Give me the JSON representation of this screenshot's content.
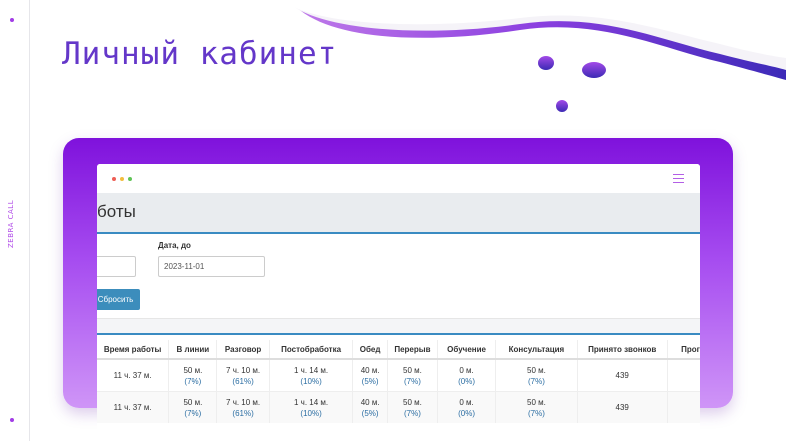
{
  "brand": {
    "side_text": "ZEBRA CALL",
    "accent": "#a23de6"
  },
  "header": {
    "title": "Личный кабинет"
  },
  "window": {
    "page_title": "боты",
    "filters": {
      "date_to_label": "Дата, до",
      "date_to_value": "2023-11-01",
      "reset_label": "Сбросить"
    },
    "table": {
      "columns": [
        "Время работы",
        "В линии",
        "Разговор",
        "Постобработка",
        "Обед",
        "Перерыв",
        "Обучение",
        "Консультация",
        "Принято звонков",
        "Прог"
      ],
      "rows": [
        {
          "work": "11 ч. 37 м.",
          "line": "50 м.",
          "line_pct": "(7%)",
          "talk": "7 ч. 10 м.",
          "talk_pct": "(61%)",
          "post": "1 ч. 14 м.",
          "post_pct": "(10%)",
          "lunch": "40 м.",
          "lunch_pct": "(5%)",
          "break": "50 м.",
          "break_pct": "(7%)",
          "training": "0 м.",
          "training_pct": "(0%)",
          "consult": "50 м.",
          "consult_pct": "(7%)",
          "calls": "439"
        },
        {
          "work": "11 ч. 37 м.",
          "line": "50 м.",
          "line_pct": "(7%)",
          "talk": "7 ч. 10 м.",
          "talk_pct": "(61%)",
          "post": "1 ч. 14 м.",
          "post_pct": "(10%)",
          "lunch": "40 м.",
          "lunch_pct": "(5%)",
          "break": "50 м.",
          "break_pct": "(7%)",
          "training": "0 м.",
          "training_pct": "(0%)",
          "consult": "50 м.",
          "consult_pct": "(7%)",
          "calls": "439"
        }
      ]
    }
  }
}
